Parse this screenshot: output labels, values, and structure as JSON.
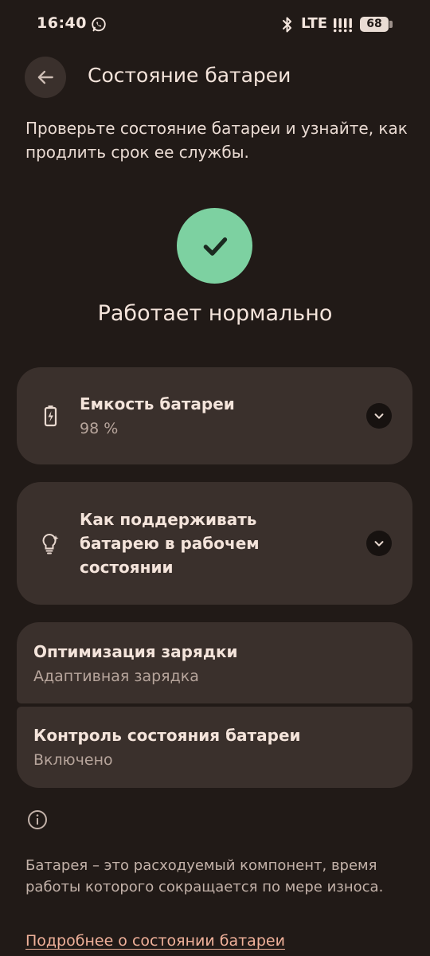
{
  "status_bar": {
    "time": "16:40",
    "network": "LTE",
    "battery_level": "68",
    "icons": [
      "whatsapp-icon",
      "bluetooth-icon",
      "signal-icon",
      "battery-icon"
    ]
  },
  "header": {
    "back_icon": "arrow-left-icon",
    "title": "Состояние батареи"
  },
  "description": "Проверьте состояние батареи и узнайте, как продлить срок ее службы.",
  "health": {
    "icon": "check-icon",
    "status": "Работает нормально",
    "color": "#7dd1a1"
  },
  "cards": {
    "capacity": {
      "icon": "battery-charging-icon",
      "title": "Емкость батареи",
      "value": "98 %"
    },
    "tips": {
      "icon": "lightbulb-icon",
      "title": "Как поддерживать батарею в рабочем состоянии"
    },
    "optimization": {
      "title": "Оптимизация зарядки",
      "value": "Адаптивная зарядка"
    },
    "control": {
      "title": "Контроль состояния батареи",
      "value": "Включено"
    }
  },
  "footer": {
    "info_icon": "info-icon",
    "text": "Батарея – это расходуемый компонент, время работы которого сокращается по мере износа.",
    "link": "Подробнее о состоянии батареи"
  },
  "colors": {
    "background": "#211a17",
    "card": "#3a302c",
    "link": "#f0b19a"
  }
}
